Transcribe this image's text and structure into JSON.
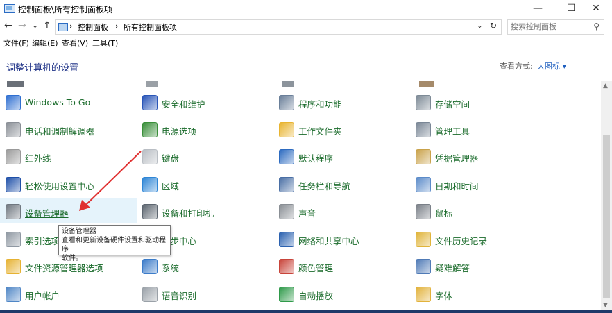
{
  "window": {
    "title": "控制面板\\所有控制面板项",
    "minimize": "—",
    "maximize": "☐",
    "close": "✕"
  },
  "nav": {
    "back": "←",
    "forward": "→",
    "recent": "⌄",
    "up": "↑"
  },
  "address": {
    "separator1": "›",
    "crumb1": "控制面板",
    "separator2": "›",
    "crumb2": "所有控制面板项",
    "dropdown": "⌄",
    "refresh": "↻"
  },
  "search": {
    "placeholder": "搜索控制面板",
    "icon": "⚲"
  },
  "menu": {
    "file": "文件(F)",
    "edit": "编辑(E)",
    "view": "查看(V)",
    "tools": "工具(T)"
  },
  "header": {
    "title": "调整计算机的设置",
    "view_by": "查看方式:",
    "view_value": "大图标 ▾"
  },
  "items": [
    {
      "label": "Windows To Go",
      "icon": "usb-drive-icon",
      "color": "#2f6fd1"
    },
    {
      "label": "安全和维护",
      "icon": "flag-icon",
      "color": "#2a56b8"
    },
    {
      "label": "程序和功能",
      "icon": "programs-icon",
      "color": "#6a7f99"
    },
    {
      "label": "存储空间",
      "icon": "storage-icon",
      "color": "#7d8a96"
    },
    {
      "label": "电话和调制解调器",
      "icon": "phone-icon",
      "color": "#8a8f96"
    },
    {
      "label": "电源选项",
      "icon": "power-icon",
      "color": "#3a8f3a"
    },
    {
      "label": "工作文件夹",
      "icon": "folder-icon",
      "color": "#e8b431"
    },
    {
      "label": "管理工具",
      "icon": "admin-tools-icon",
      "color": "#7a8796"
    },
    {
      "label": "红外线",
      "icon": "infrared-icon",
      "color": "#9a9a9a"
    },
    {
      "label": "键盘",
      "icon": "keyboard-icon",
      "color": "#b9bec4"
    },
    {
      "label": "默认程序",
      "icon": "default-programs-icon",
      "color": "#2d6bc0"
    },
    {
      "label": "凭据管理器",
      "icon": "credential-icon",
      "color": "#c9a24a"
    },
    {
      "label": "轻松使用设置中心",
      "icon": "ease-of-access-icon",
      "color": "#1e4fa8"
    },
    {
      "label": "区域",
      "icon": "globe-icon",
      "color": "#2f86d6"
    },
    {
      "label": "任务栏和导航",
      "icon": "taskbar-icon",
      "color": "#4a6fa5"
    },
    {
      "label": "日期和时间",
      "icon": "calendar-icon",
      "color": "#5b8bc9"
    },
    {
      "label": "设备管理器",
      "icon": "device-manager-icon",
      "color": "#6f7780"
    },
    {
      "label": "设备和打印机",
      "icon": "printer-icon",
      "color": "#5d6670"
    },
    {
      "label": "声音",
      "icon": "speaker-icon",
      "color": "#8a8f95"
    },
    {
      "label": "鼠标",
      "icon": "mouse-icon",
      "color": "#7a8088"
    },
    {
      "label": "索引选项",
      "icon": "indexing-icon",
      "color": "#8f98a2"
    },
    {
      "label": "同步中心",
      "icon": "sync-icon",
      "color": "#3d9a3d"
    },
    {
      "label": "网络和共享中心",
      "icon": "network-icon",
      "color": "#2c62b0"
    },
    {
      "label": "文件历史记录",
      "icon": "file-history-icon",
      "color": "#e0b43a"
    },
    {
      "label": "文件资源管理器选项",
      "icon": "folder-options-icon",
      "color": "#e6b232"
    },
    {
      "label": "系统",
      "icon": "system-icon",
      "color": "#3d7cc9"
    },
    {
      "label": "颜色管理",
      "icon": "color-management-icon",
      "color": "#c8443a"
    },
    {
      "label": "疑难解答",
      "icon": "troubleshoot-icon",
      "color": "#4f7ab6"
    },
    {
      "label": "用户帐户",
      "icon": "user-accounts-icon",
      "color": "#4f86c6"
    },
    {
      "label": "语音识别",
      "icon": "microphone-icon",
      "color": "#9aa1a8"
    },
    {
      "label": "自动播放",
      "icon": "autoplay-icon",
      "color": "#2f9a4a"
    },
    {
      "label": "字体",
      "icon": "fonts-icon",
      "color": "#e2b23b"
    }
  ],
  "tooltip": {
    "title": "设备管理器",
    "line1": "查看和更新设备硬件设置和驱动程序",
    "line2": "软件。"
  },
  "scrollbar": {
    "up": "▲",
    "down": "▼"
  }
}
